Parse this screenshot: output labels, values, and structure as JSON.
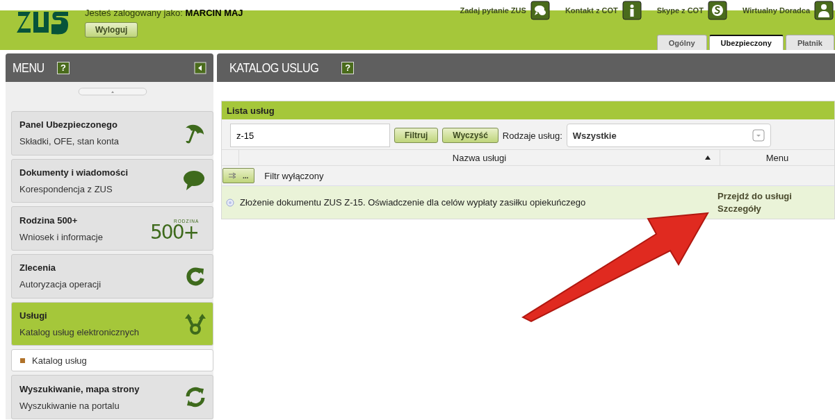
{
  "header": {
    "logged_in_label": "Jesteś zalogowany jako:",
    "user": "MARCIN MAJ",
    "logout": "Wyloguj",
    "links": [
      {
        "label": "Zadaj pytanie ZUS",
        "kind": "chat"
      },
      {
        "label": "Kontakt z COT",
        "kind": "info"
      },
      {
        "label": "Skype z COT",
        "kind": "skype"
      },
      {
        "label": "Wirtualny Doradca",
        "kind": "person"
      }
    ],
    "tabs": [
      {
        "label": "Ogólny",
        "selected": false
      },
      {
        "label": "Ubezpieczony",
        "selected": true
      },
      {
        "label": "Płatnik",
        "selected": false
      }
    ]
  },
  "menu": {
    "title": "MENU",
    "help": "?",
    "items": [
      {
        "title": "Panel Ubezpieczonego",
        "subtitle": "Składki, OFE, stan konta",
        "kind": "umbrella",
        "selected": false
      },
      {
        "title": "Dokumenty i wiadomości",
        "subtitle": "Korespondencja z ZUS",
        "kind": "speech",
        "selected": false
      },
      {
        "title": "Rodzina 500+",
        "subtitle": "Wniosek i informacje",
        "kind": "logo",
        "logo_caption": "RODZINA",
        "logo_text": "500+",
        "selected": false
      },
      {
        "title": "Zlecenia",
        "subtitle": "Autoryzacja operacji",
        "kind": "refresh",
        "selected": false
      },
      {
        "title": "Usługi",
        "subtitle": "Katalog usług elektronicznych",
        "kind": "fork",
        "selected": true,
        "children": [
          {
            "label": "Katalog usług"
          }
        ]
      },
      {
        "title": "Wyszukiwanie, mapa strony",
        "subtitle": "Wyszukiwanie na portalu",
        "kind": "sync",
        "selected": false
      }
    ]
  },
  "main": {
    "title": "KATALOG USLUG",
    "help": "?",
    "panel": {
      "title": "Lista usług",
      "search_value": "z-15",
      "filter_button": "Filtruj",
      "clear_button": "Wyczyść",
      "type_label": "Rodzaje usług:",
      "type_value": "Wszystkie",
      "columns": [
        "Nazwa usługi",
        "Menu"
      ],
      "filter_toggle": "...",
      "filter_status": "Filtr wyłączony",
      "rows": [
        {
          "name": "Złożenie dokumentu ZUS Z-15. Oświadczenie dla celów wypłaty zasiłku opiekuńczego",
          "actions": [
            "Przejdź do usługi",
            "Szczegóły"
          ]
        }
      ]
    }
  }
}
